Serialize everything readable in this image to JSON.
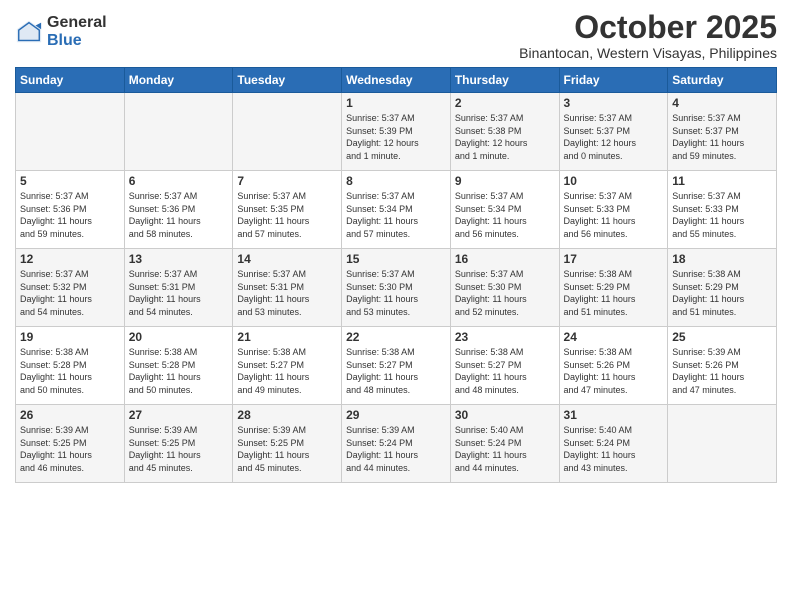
{
  "header": {
    "logo_general": "General",
    "logo_blue": "Blue",
    "month_title": "October 2025",
    "location": "Binantocan, Western Visayas, Philippines"
  },
  "weekdays": [
    "Sunday",
    "Monday",
    "Tuesday",
    "Wednesday",
    "Thursday",
    "Friday",
    "Saturday"
  ],
  "weeks": [
    [
      {
        "day": "",
        "info": ""
      },
      {
        "day": "",
        "info": ""
      },
      {
        "day": "",
        "info": ""
      },
      {
        "day": "1",
        "info": "Sunrise: 5:37 AM\nSunset: 5:39 PM\nDaylight: 12 hours\nand 1 minute."
      },
      {
        "day": "2",
        "info": "Sunrise: 5:37 AM\nSunset: 5:38 PM\nDaylight: 12 hours\nand 1 minute."
      },
      {
        "day": "3",
        "info": "Sunrise: 5:37 AM\nSunset: 5:37 PM\nDaylight: 12 hours\nand 0 minutes."
      },
      {
        "day": "4",
        "info": "Sunrise: 5:37 AM\nSunset: 5:37 PM\nDaylight: 11 hours\nand 59 minutes."
      }
    ],
    [
      {
        "day": "5",
        "info": "Sunrise: 5:37 AM\nSunset: 5:36 PM\nDaylight: 11 hours\nand 59 minutes."
      },
      {
        "day": "6",
        "info": "Sunrise: 5:37 AM\nSunset: 5:36 PM\nDaylight: 11 hours\nand 58 minutes."
      },
      {
        "day": "7",
        "info": "Sunrise: 5:37 AM\nSunset: 5:35 PM\nDaylight: 11 hours\nand 57 minutes."
      },
      {
        "day": "8",
        "info": "Sunrise: 5:37 AM\nSunset: 5:34 PM\nDaylight: 11 hours\nand 57 minutes."
      },
      {
        "day": "9",
        "info": "Sunrise: 5:37 AM\nSunset: 5:34 PM\nDaylight: 11 hours\nand 56 minutes."
      },
      {
        "day": "10",
        "info": "Sunrise: 5:37 AM\nSunset: 5:33 PM\nDaylight: 11 hours\nand 56 minutes."
      },
      {
        "day": "11",
        "info": "Sunrise: 5:37 AM\nSunset: 5:33 PM\nDaylight: 11 hours\nand 55 minutes."
      }
    ],
    [
      {
        "day": "12",
        "info": "Sunrise: 5:37 AM\nSunset: 5:32 PM\nDaylight: 11 hours\nand 54 minutes."
      },
      {
        "day": "13",
        "info": "Sunrise: 5:37 AM\nSunset: 5:31 PM\nDaylight: 11 hours\nand 54 minutes."
      },
      {
        "day": "14",
        "info": "Sunrise: 5:37 AM\nSunset: 5:31 PM\nDaylight: 11 hours\nand 53 minutes."
      },
      {
        "day": "15",
        "info": "Sunrise: 5:37 AM\nSunset: 5:30 PM\nDaylight: 11 hours\nand 53 minutes."
      },
      {
        "day": "16",
        "info": "Sunrise: 5:37 AM\nSunset: 5:30 PM\nDaylight: 11 hours\nand 52 minutes."
      },
      {
        "day": "17",
        "info": "Sunrise: 5:38 AM\nSunset: 5:29 PM\nDaylight: 11 hours\nand 51 minutes."
      },
      {
        "day": "18",
        "info": "Sunrise: 5:38 AM\nSunset: 5:29 PM\nDaylight: 11 hours\nand 51 minutes."
      }
    ],
    [
      {
        "day": "19",
        "info": "Sunrise: 5:38 AM\nSunset: 5:28 PM\nDaylight: 11 hours\nand 50 minutes."
      },
      {
        "day": "20",
        "info": "Sunrise: 5:38 AM\nSunset: 5:28 PM\nDaylight: 11 hours\nand 50 minutes."
      },
      {
        "day": "21",
        "info": "Sunrise: 5:38 AM\nSunset: 5:27 PM\nDaylight: 11 hours\nand 49 minutes."
      },
      {
        "day": "22",
        "info": "Sunrise: 5:38 AM\nSunset: 5:27 PM\nDaylight: 11 hours\nand 48 minutes."
      },
      {
        "day": "23",
        "info": "Sunrise: 5:38 AM\nSunset: 5:27 PM\nDaylight: 11 hours\nand 48 minutes."
      },
      {
        "day": "24",
        "info": "Sunrise: 5:38 AM\nSunset: 5:26 PM\nDaylight: 11 hours\nand 47 minutes."
      },
      {
        "day": "25",
        "info": "Sunrise: 5:39 AM\nSunset: 5:26 PM\nDaylight: 11 hours\nand 47 minutes."
      }
    ],
    [
      {
        "day": "26",
        "info": "Sunrise: 5:39 AM\nSunset: 5:25 PM\nDaylight: 11 hours\nand 46 minutes."
      },
      {
        "day": "27",
        "info": "Sunrise: 5:39 AM\nSunset: 5:25 PM\nDaylight: 11 hours\nand 45 minutes."
      },
      {
        "day": "28",
        "info": "Sunrise: 5:39 AM\nSunset: 5:25 PM\nDaylight: 11 hours\nand 45 minutes."
      },
      {
        "day": "29",
        "info": "Sunrise: 5:39 AM\nSunset: 5:24 PM\nDaylight: 11 hours\nand 44 minutes."
      },
      {
        "day": "30",
        "info": "Sunrise: 5:40 AM\nSunset: 5:24 PM\nDaylight: 11 hours\nand 44 minutes."
      },
      {
        "day": "31",
        "info": "Sunrise: 5:40 AM\nSunset: 5:24 PM\nDaylight: 11 hours\nand 43 minutes."
      },
      {
        "day": "",
        "info": ""
      }
    ]
  ]
}
